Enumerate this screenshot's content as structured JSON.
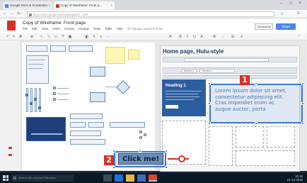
{
  "browser": {
    "tabs": [
      {
        "label": "Google Docs & Screensho",
        "active": false
      },
      {
        "label": "Copy of Wireframe: Front p...",
        "active": true
      }
    ],
    "address": "https://docs.google.com/drawings/d/1.../edit"
  },
  "app": {
    "doc_title": "Copy of Wireframe: Front page",
    "menu": [
      "File",
      "Edit",
      "View",
      "Insert",
      "Format",
      "Arrange",
      "Tools",
      "Table",
      "Help",
      "All changes saved in Drive"
    ],
    "comments_label": "Comments",
    "share_label": "Share"
  },
  "mockup": {
    "title": "Home page, Hulu-style",
    "section_tab": "Section 1",
    "hero_heading": "Heading 1",
    "lorem": "Lorem ipsum dolor sit amet,\nconsectetur adipiscing elit.\nCras imperdiet enim ac\naugue auctor, porta"
  },
  "button": {
    "label": "Click me!"
  },
  "badges": {
    "one": "1",
    "two": "2"
  },
  "taskbar": {
    "search_placeholder": "Search the web and Windows",
    "clock": "11:19\n01-12-2015"
  },
  "colors": {
    "accent": "#3c78d8",
    "badge": "#d93025",
    "brand": "#d93025"
  }
}
